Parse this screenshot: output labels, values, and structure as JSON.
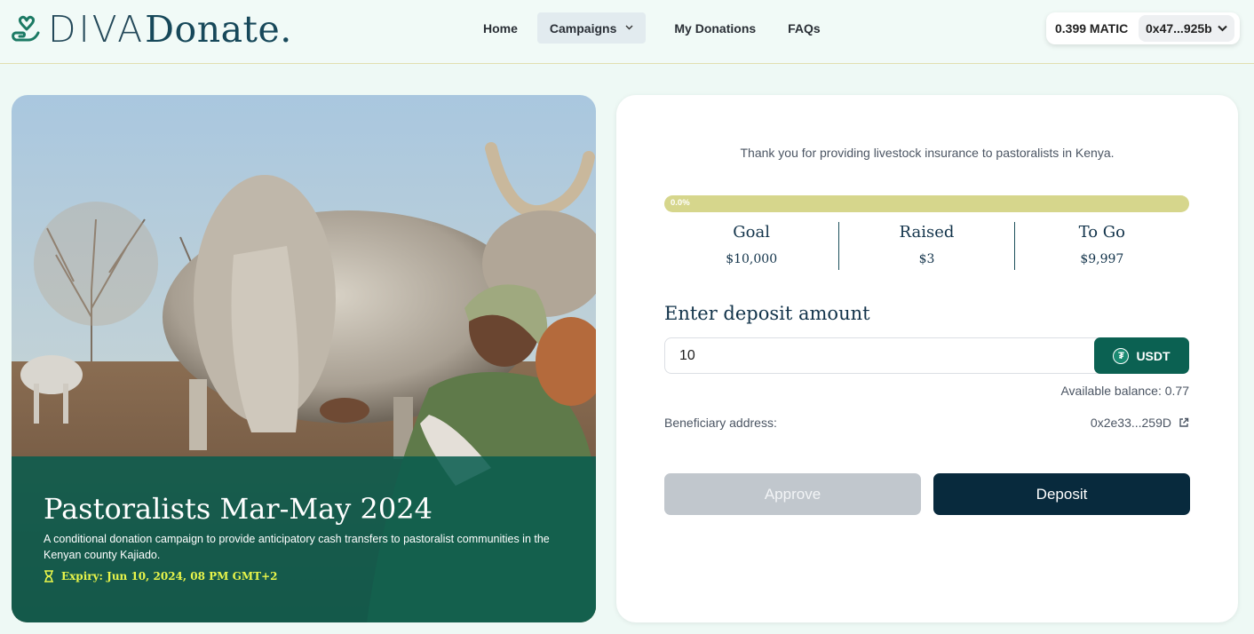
{
  "brand": {
    "logo_prefix": "DIVA",
    "logo_name": "Donate."
  },
  "nav": {
    "items": [
      {
        "label": "Home"
      },
      {
        "label": "Campaigns"
      },
      {
        "label": "My Donations"
      },
      {
        "label": "FAQs"
      }
    ]
  },
  "wallet": {
    "balance": "0.399 MATIC",
    "address": "0x47...925b"
  },
  "campaign": {
    "title": "Pastoralists Mar-May 2024",
    "description": "A conditional donation campaign to provide anticipatory cash transfers to pastoralist communities in the Kenyan county Kajiado.",
    "expiry": "Expiry: Jun 10, 2024, 08 PM GMT+2"
  },
  "panel": {
    "thanks": "Thank you for providing livestock insurance to pastoralists in Kenya.",
    "progress": {
      "label": "0.0%",
      "fraction": 0.0
    },
    "stats": [
      {
        "label": "Goal",
        "value": "$10,000"
      },
      {
        "label": "Raised",
        "value": "$3"
      },
      {
        "label": "To Go",
        "value": "$9,997"
      }
    ],
    "deposit_title": "Enter deposit amount",
    "amount_value": "10",
    "token": "USDT",
    "available_balance": "Available balance: 0.77",
    "beneficiary_label": "Beneficiary address:",
    "beneficiary_address": "0x2e33...259D",
    "approve_label": "Approve",
    "deposit_label": "Deposit"
  },
  "colors": {
    "brand_dark": "#17485a",
    "accent_green": "#0b6152",
    "progress_track": "#d6d68c",
    "deposit_button": "#082a3d",
    "approve_disabled": "#c1c7cd",
    "expiry_text": "#e8f54a"
  }
}
